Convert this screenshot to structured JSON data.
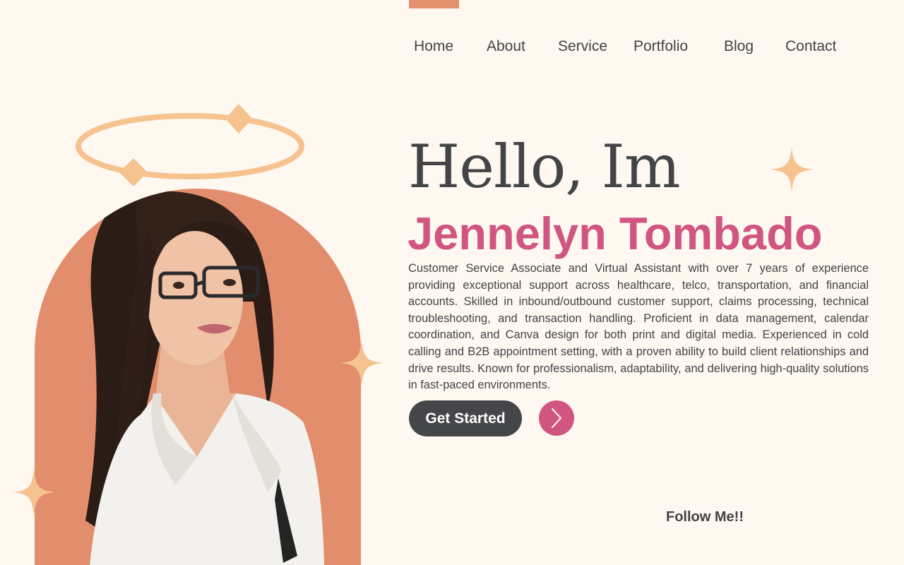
{
  "nav": {
    "items": [
      {
        "label": "Home"
      },
      {
        "label": "About"
      },
      {
        "label": "Service"
      },
      {
        "label": "Portfolio"
      },
      {
        "label": "Blog"
      },
      {
        "label": "Contact"
      }
    ]
  },
  "hero": {
    "greeting": "Hello, Im",
    "name": "Jennelyn Tombado",
    "bio": "Customer Service Associate and Virtual Assistant with over 7 years of experience providing exceptional support across healthcare, telco, transportation, and financial accounts. Skilled in inbound/outbound customer support, claims processing, technical troubleshooting, and transaction handling. Proficient in data management, calendar coordination, and Canva design for both print and digital media. Experienced in cold calling and B2B appointment setting, with a proven ability to build client relationships and drive results. Known for professionalism, adaptability, and delivering high-quality solutions in fast-paced environments.",
    "cta_label": "Get Started",
    "arrow_icon": "chevron-right-icon"
  },
  "follow": {
    "label": "Follow Me!!"
  },
  "icons": {
    "halo": "halo-icon",
    "sparkle": "sparkle-icon"
  },
  "colors": {
    "background": "#fef8f1",
    "accent_orange": "#e28e6c",
    "accent_pink": "#d05581",
    "sparkle_peach": "#f6c28f",
    "text_dark": "#434345",
    "button_dark": "#454649"
  }
}
